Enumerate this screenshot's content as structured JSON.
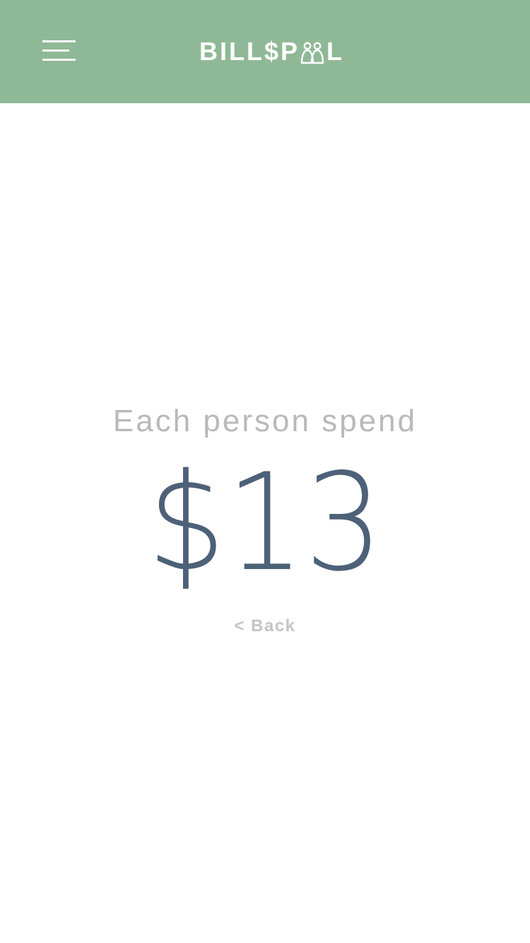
{
  "header": {
    "background_color": "#8fb996",
    "menu_icon": "hamburger-menu-icon",
    "brand": {
      "text": "BILL$POOL",
      "part1": "BILL$P",
      "logo_icon": "people-icon",
      "part2": "L"
    }
  },
  "main": {
    "label": "Each person spend",
    "amount": "$13",
    "amount_color": "#4d6178",
    "label_color": "#b9b9b9",
    "back_link": "< Back"
  }
}
